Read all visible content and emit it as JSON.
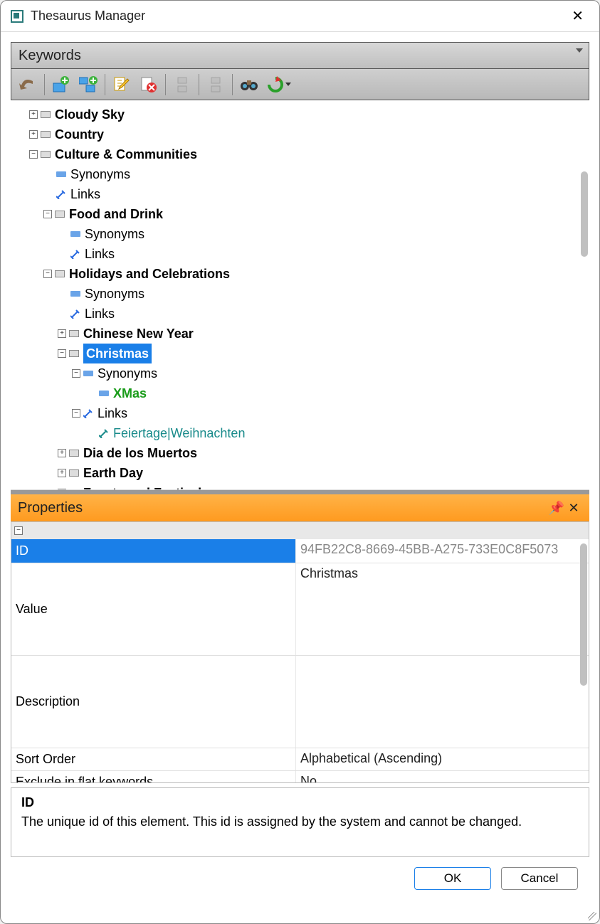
{
  "window": {
    "title": "Thesaurus Manager"
  },
  "combo": {
    "value": "Keywords"
  },
  "toolbar": {
    "undo": "undo",
    "add_sibling": "add-sibling",
    "add_child": "add-child",
    "edit": "edit",
    "delete": "delete",
    "move_up": "move-up",
    "move_down": "move-down",
    "find": "find",
    "refresh": "refresh"
  },
  "tree": {
    "synonyms_label": "Synonyms",
    "links_label": "Links",
    "items": [
      {
        "label": "Cloudy Sky"
      },
      {
        "label": "Country"
      },
      {
        "label": "Culture & Communities"
      },
      {
        "label": "Food and Drink"
      },
      {
        "label": "Holidays and Celebrations"
      },
      {
        "label": "Chinese New Year"
      },
      {
        "label": "Christmas"
      },
      {
        "label": "XMas"
      },
      {
        "label": "Feiertage|Weihnachten"
      },
      {
        "label": "Dia de los Muertos"
      },
      {
        "label": "Earth Day"
      },
      {
        "label": "Feasts and Festivals"
      }
    ]
  },
  "properties": {
    "panel_title": "Properties",
    "rows": [
      {
        "name": "ID",
        "value": "94FB22C8-8669-45BB-A275-733E0C8F5073"
      },
      {
        "name": "Value",
        "value": "Christmas"
      },
      {
        "name": "Description",
        "value": ""
      },
      {
        "name": "Sort Order",
        "value": "Alphabetical (Ascending)"
      },
      {
        "name": "Exclude in flat keywords",
        "value": "No"
      }
    ],
    "help": {
      "title": "ID",
      "text": "The unique id of this element. This id is assigned by the system and cannot be changed."
    }
  },
  "buttons": {
    "ok": "OK",
    "cancel": "Cancel"
  }
}
